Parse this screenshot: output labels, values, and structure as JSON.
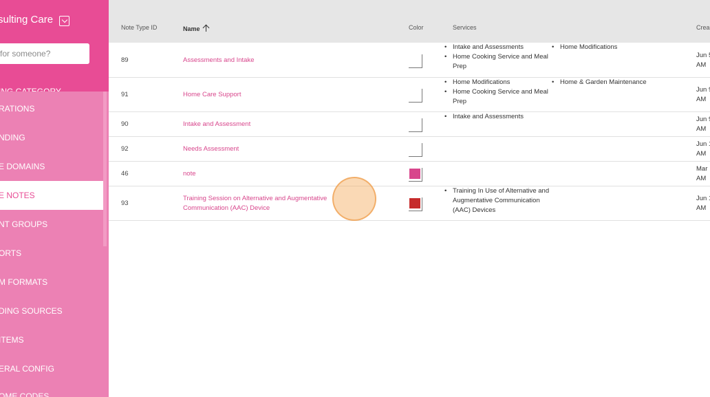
{
  "sidebar": {
    "org_title": "sulting Care",
    "search_placeholder": "for someone?",
    "items": [
      {
        "label": "ING CATEGORY"
      },
      {
        "label": "RATIONS"
      },
      {
        "label": "NDING"
      },
      {
        "label": "E DOMAINS"
      },
      {
        "label": "E NOTES"
      },
      {
        "label": "NT GROUPS"
      },
      {
        "label": "ORTS"
      },
      {
        "label": "M FORMATS"
      },
      {
        "label": "DING SOURCES"
      },
      {
        "label": "ITEMS"
      },
      {
        "label": "ERAL CONFIG"
      },
      {
        "label": "OME CODES"
      }
    ],
    "active_index": 4
  },
  "table": {
    "headers": {
      "id": "Note Type ID",
      "name": "Name",
      "color": "Color",
      "services": "Services",
      "created": "Crea"
    },
    "sort": "ascending",
    "rows": [
      {
        "id": "89",
        "name": [
          "Assessments and Intake"
        ],
        "color": "#ffffff",
        "services_col1": [
          "Intake and Assessments",
          "Home Cooking Service and Meal Prep"
        ],
        "services_col2": [
          "Home Modifications"
        ],
        "created": [
          "Jun 5",
          "AM"
        ]
      },
      {
        "id": "91",
        "name": [
          "Home Care Support"
        ],
        "color": "#ffffff",
        "services_col1": [
          "Home Modifications",
          "Home Cooking Service and Meal Prep"
        ],
        "services_col2": [
          "Home & Garden Maintenance"
        ],
        "created": [
          "Jun 9",
          "AM"
        ]
      },
      {
        "id": "90",
        "name": [
          "Intake and Assessment"
        ],
        "color": "#ffffff",
        "services_col1": [
          "Intake and Assessments"
        ],
        "services_col2": [],
        "created": [
          "Jun 9",
          "AM"
        ]
      },
      {
        "id": "92",
        "name": [
          "Needs Assessment"
        ],
        "color": "#ffffff",
        "services_col1": [],
        "services_col2": [],
        "created": [
          "Jun 1",
          "AM"
        ]
      },
      {
        "id": "46",
        "name": [
          "note"
        ],
        "color": "#d8468c",
        "services_col1": [],
        "services_col2": [],
        "created": [
          "Mar",
          "AM"
        ]
      },
      {
        "id": "93",
        "name": [
          "Training Session on Alternative and Augmentative",
          "Communication (AAC) Device"
        ],
        "color": "#c62b2b",
        "services_col1": [
          "Training In Use of Alternative and Augmentative Communication (AAC) Devices"
        ],
        "services_col2": [],
        "created": [
          "Jun 1",
          "AM"
        ]
      }
    ]
  },
  "colors": {
    "brand_primary": "#e84c95",
    "sidebar_bg": "#ec81b4",
    "link": "#d8468c",
    "header_bg": "#e6e6e6"
  }
}
